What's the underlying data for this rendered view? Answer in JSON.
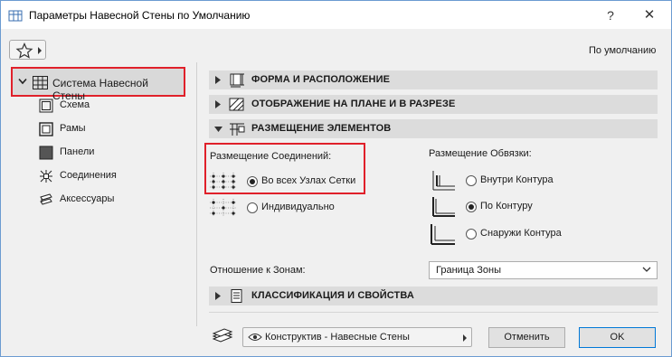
{
  "window": {
    "title": "Параметры Навесной Стены по Умолчанию",
    "help": "?",
    "close": "✕"
  },
  "toolbar": {
    "default_label": "По умолчанию"
  },
  "sidebar": {
    "root_label": "Система Навесной Стены",
    "items": [
      {
        "label": "Схема",
        "icon": "scheme-icon"
      },
      {
        "label": "Рамы",
        "icon": "frame-icon"
      },
      {
        "label": "Панели",
        "icon": "panel-icon"
      },
      {
        "label": "Соединения",
        "icon": "junction-icon"
      },
      {
        "label": "Аксессуары",
        "icon": "accessory-icon"
      }
    ]
  },
  "sections": {
    "shape": {
      "label": "ФОРМА И РАСПОЛОЖЕНИЕ",
      "expanded": false
    },
    "display": {
      "label": "ОТОБРАЖЕНИЕ НА ПЛАНЕ И В РАЗРЕЗЕ",
      "expanded": false
    },
    "placement": {
      "label": "РАЗМЕЩЕНИЕ ЭЛЕМЕНТОВ",
      "expanded": true
    },
    "classification": {
      "label": "КЛАССИФИКАЦИЯ И СВОЙСТВА",
      "expanded": false
    }
  },
  "placement": {
    "junctions": {
      "label": "Размещение Соединений:",
      "options": [
        {
          "label": "Во всех Узлах Сетки",
          "selected": true
        },
        {
          "label": "Индивидуально",
          "selected": false
        }
      ]
    },
    "boundary": {
      "label": "Размещение Обвязки:",
      "options": [
        {
          "label": "Внутри Контура",
          "selected": false
        },
        {
          "label": "По Контуру",
          "selected": true
        },
        {
          "label": "Снаружи Контура",
          "selected": false
        }
      ]
    },
    "zone": {
      "label": "Отношение к Зонам:",
      "value": "Граница Зоны"
    }
  },
  "footer": {
    "layer_value": "Конструктив - Навесные Стены",
    "cancel_label": "Отменить",
    "ok_label": "OK"
  },
  "colors": {
    "highlight": "#e0202a",
    "section_header": "#dcdcdc",
    "ok_border": "#0078d7"
  }
}
